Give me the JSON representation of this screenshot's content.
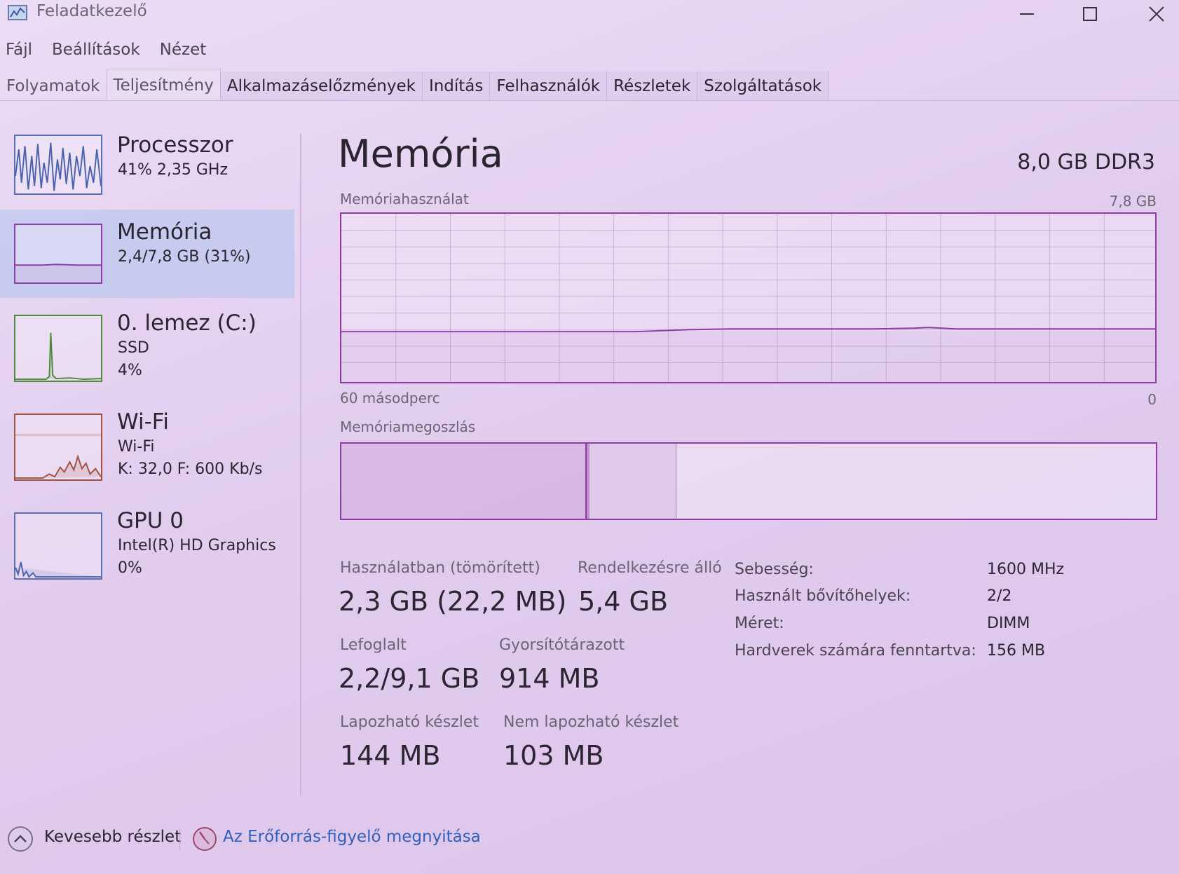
{
  "window": {
    "title": "Feladatkezelő"
  },
  "menu": [
    "Fájl",
    "Beállítások",
    "Nézet"
  ],
  "tabs": [
    "Folyamatok",
    "Teljesítmény",
    "Alkalmazáselőzmények",
    "Indítás",
    "Felhasználók",
    "Részletek",
    "Szolgáltatások"
  ],
  "active_tab": "Teljesítmény",
  "sidebar": [
    {
      "title": "Processzor",
      "line1": "41% 2,35 GHz",
      "line2": ""
    },
    {
      "title": "Memória",
      "line1": "2,4/7,8 GB (31%)",
      "line2": ""
    },
    {
      "title": "0. lemez (C:)",
      "line1": "SSD",
      "line2": "4%"
    },
    {
      "title": "Wi-Fi",
      "line1": "Wi-Fi",
      "line2": "K: 32,0 F: 600 Kb/s"
    },
    {
      "title": "GPU 0",
      "line1": "Intel(R) HD Graphics",
      "line2": "0%"
    }
  ],
  "selected_sidebar": "Memória",
  "main": {
    "title": "Memória",
    "spec": "8,0 GB DDR3",
    "usage_chart": {
      "label": "Memóriahasználat",
      "max_label": "7,8 GB",
      "time_label": "60 másodperc",
      "min_label": "0"
    },
    "composition_chart": {
      "label": "Memóriamegoszlás"
    }
  },
  "stats": {
    "in_use": {
      "label": "Használatban (tömörített)",
      "value": "2,3 GB (22,2 MB)"
    },
    "available": {
      "label": "Rendelkezésre álló",
      "value": "5,4 GB"
    },
    "committed": {
      "label": "Lefoglalt",
      "value": "2,2/9,1 GB"
    },
    "cached": {
      "label": "Gyorsítótárazott",
      "value": "914 MB"
    },
    "paged_pool": {
      "label": "Lapozható készlet",
      "value": "144 MB"
    },
    "nonpaged_pool": {
      "label": "Nem lapozható készlet",
      "value": "103 MB"
    }
  },
  "properties": [
    {
      "label": "Sebesség:",
      "value": "1600 MHz"
    },
    {
      "label": "Használt bővítőhelyek:",
      "value": "2/2"
    },
    {
      "label": "Méret:",
      "value": "DIMM"
    },
    {
      "label": "Hardverek számára fenntartva:",
      "value": "156 MB"
    }
  ],
  "footer": {
    "fewer_details": "Kevesebb részlet",
    "open_resmon": "Az Erőforrás-figyelő megnyitása"
  },
  "colors": {
    "memory": "#8e3aa7",
    "cpu": "#5a70b5",
    "disk": "#4f8a3a",
    "wifi": "#a0523e",
    "link": "#2f5fbf"
  }
}
